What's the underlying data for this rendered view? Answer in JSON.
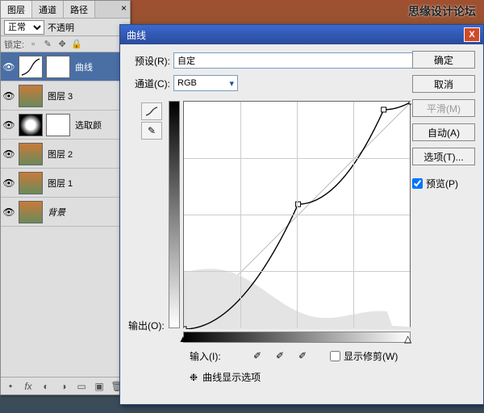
{
  "watermark": "思缘设计论坛",
  "layers_panel": {
    "tabs": [
      "图层",
      "通道",
      "路径"
    ],
    "blend_mode": "正常",
    "opacity_label": "不透明",
    "lock_label": "锁定:",
    "layers": [
      {
        "name": "曲线",
        "type": "curves",
        "visible": true,
        "selected": true
      },
      {
        "name": "图层 3",
        "type": "photo",
        "visible": true
      },
      {
        "name": "选取颜",
        "type": "lum",
        "visible": true
      },
      {
        "name": "图层 2",
        "type": "photo",
        "visible": true
      },
      {
        "name": "图层 1",
        "type": "photo",
        "visible": true
      },
      {
        "name": "背景",
        "type": "photo",
        "visible": true,
        "italic": true
      }
    ]
  },
  "dialog": {
    "title": "曲线",
    "preset_label": "预设(R):",
    "preset_value": "自定",
    "channel_label": "通道(C):",
    "channel_value": "RGB",
    "output_label": "输出(O):",
    "input_label": "输入(I):",
    "show_clipping": "显示修剪(W)",
    "disclose": "曲线显示选项",
    "buttons": {
      "ok": "确定",
      "cancel": "取消",
      "smooth": "平滑(M)",
      "auto": "自动(A)",
      "options": "选项(T)..."
    },
    "preview_label": "预览(P)",
    "preview_checked": true
  },
  "chart_data": {
    "type": "line",
    "title": "曲线",
    "xlabel": "输入",
    "ylabel": "输出",
    "xlim": [
      0,
      255
    ],
    "ylim": [
      0,
      255
    ],
    "series": [
      {
        "name": "RGB",
        "points": [
          {
            "x": 0,
            "y": 0
          },
          {
            "x": 128,
            "y": 140
          },
          {
            "x": 224,
            "y": 246
          },
          {
            "x": 255,
            "y": 255
          }
        ]
      }
    ]
  }
}
